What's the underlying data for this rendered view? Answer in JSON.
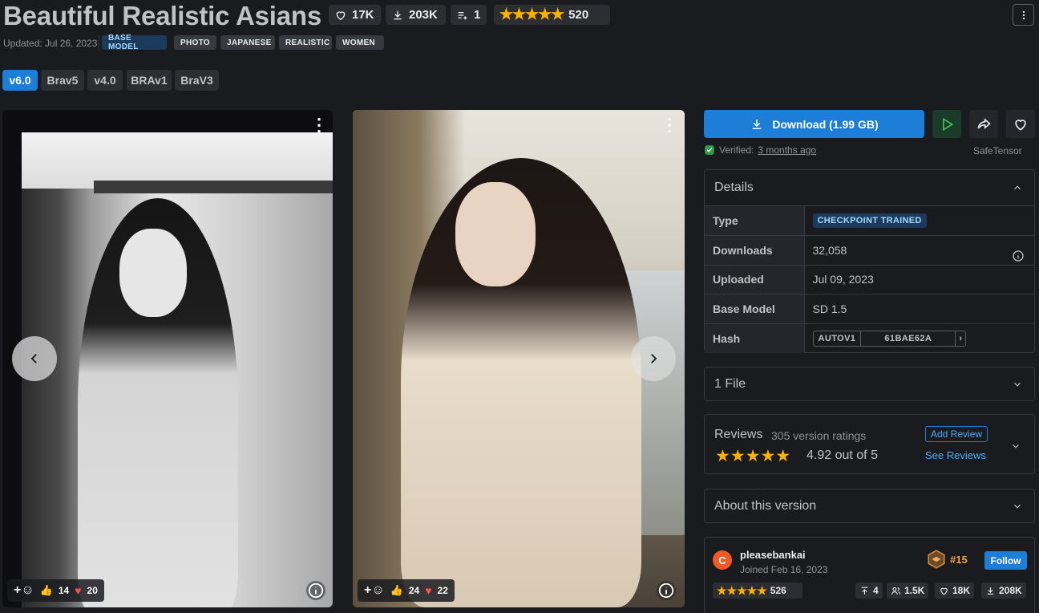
{
  "header": {
    "title": "Beautiful Realistic Asians",
    "stats": {
      "likes": "17K",
      "downloads": "203K",
      "collections": "1",
      "rating_count": "520"
    },
    "updated": "Updated: Jul 26, 2023",
    "tags": [
      "BASE MODEL",
      "PHOTO",
      "JAPANESE",
      "REALISTIC",
      "WOMEN"
    ]
  },
  "versions": [
    "v6.0",
    "Brav5",
    "v4.0",
    "BRAv1",
    "BraV3"
  ],
  "gallery": {
    "images": [
      {
        "likes": "14",
        "hearts": "20"
      },
      {
        "likes": "24",
        "hearts": "22"
      }
    ]
  },
  "download": {
    "label": "Download (1.99 GB)",
    "verified_prefix": "Verified:",
    "verified_when": "3 months ago",
    "format": "SafeTensor"
  },
  "details": {
    "heading": "Details",
    "rows": [
      {
        "key": "Type",
        "value": "CHECKPOINT TRAINED"
      },
      {
        "key": "Downloads",
        "value": "32,058"
      },
      {
        "key": "Uploaded",
        "value": "Jul 09, 2023"
      },
      {
        "key": "Base Model",
        "value": "SD 1.5"
      },
      {
        "key": "Hash",
        "hash_type": "AUTOV1",
        "value": "61BAE62A"
      }
    ]
  },
  "files": {
    "heading": "1 File"
  },
  "reviews": {
    "heading": "Reviews",
    "count": "305 version ratings",
    "score": "4.92 out of 5",
    "add": "Add Review",
    "see": "See Reviews"
  },
  "about": {
    "heading": "About this version"
  },
  "creator": {
    "initial": "C",
    "name": "pleasebankai",
    "joined": "Joined Feb 16, 2023",
    "rank": "#15",
    "follow": "Follow",
    "rating_count": "526",
    "uploads": "4",
    "followers": "1.5K",
    "likes": "18K",
    "downloads": "208K"
  },
  "colors": {
    "accent": "#1c7ed6",
    "star": "#fab005",
    "bg": "#1a1b1e",
    "panel": "#25262b"
  }
}
